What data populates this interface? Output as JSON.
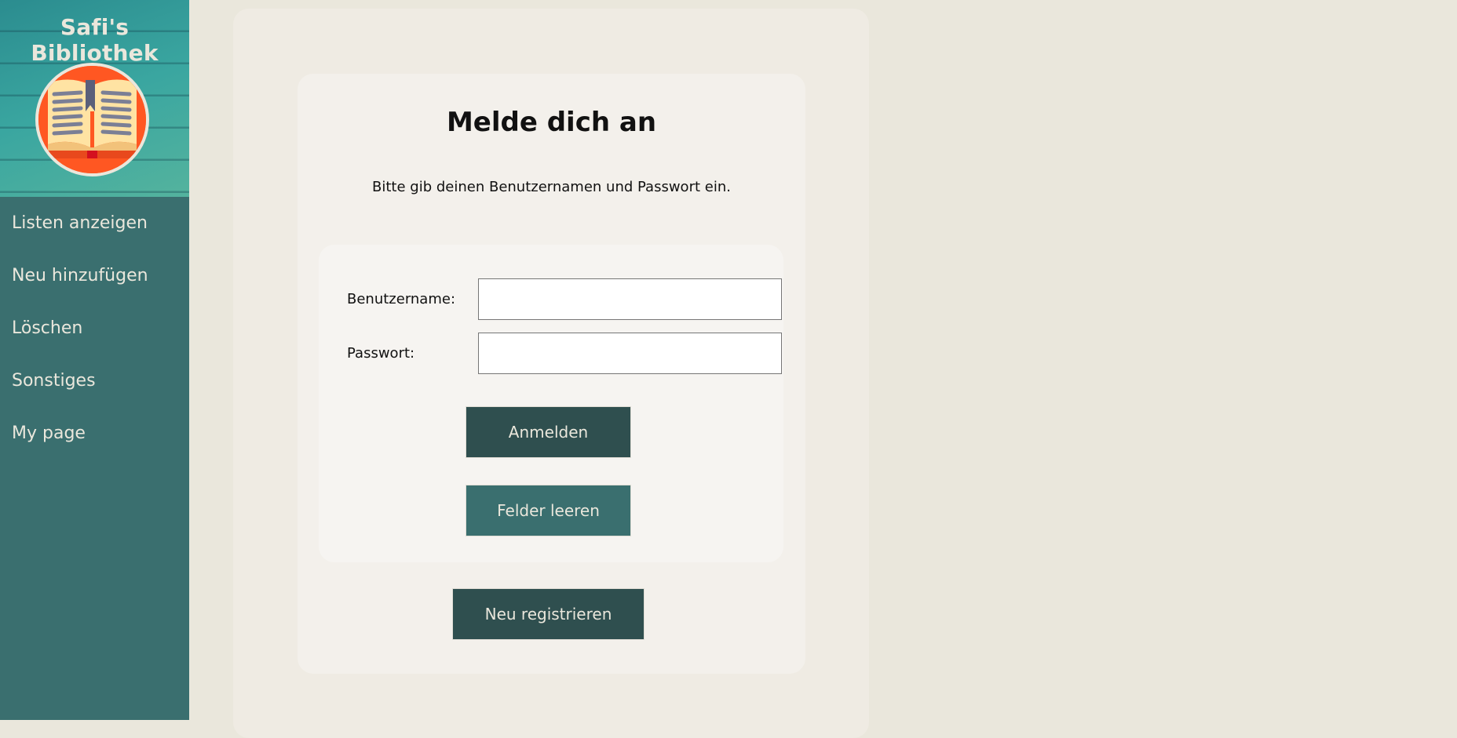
{
  "app": {
    "title": "Safi's Bibliothek",
    "logo_icon": "open-book-icon"
  },
  "sidebar": {
    "items": [
      {
        "label": "Listen anzeigen"
      },
      {
        "label": "Neu hinzufügen"
      },
      {
        "label": "Löschen"
      },
      {
        "label": "Sonstiges"
      },
      {
        "label": "My page"
      }
    ]
  },
  "login": {
    "title": "Melde dich an",
    "subtitle": "Bitte gib deinen Benutzernamen und Passwort ein.",
    "username_label": "Benutzername:",
    "username_value": "",
    "password_label": "Passwort:",
    "password_value": "",
    "submit_label": "Anmelden",
    "clear_label": "Felder leeren",
    "register_label": "Neu registrieren"
  },
  "colors": {
    "page_background": "#eae7dc",
    "sidebar": "#3a6f6f",
    "primary_button": "#2f4f4f",
    "secondary_button": "#3a6f6f",
    "text_light": "#eae7dc"
  }
}
